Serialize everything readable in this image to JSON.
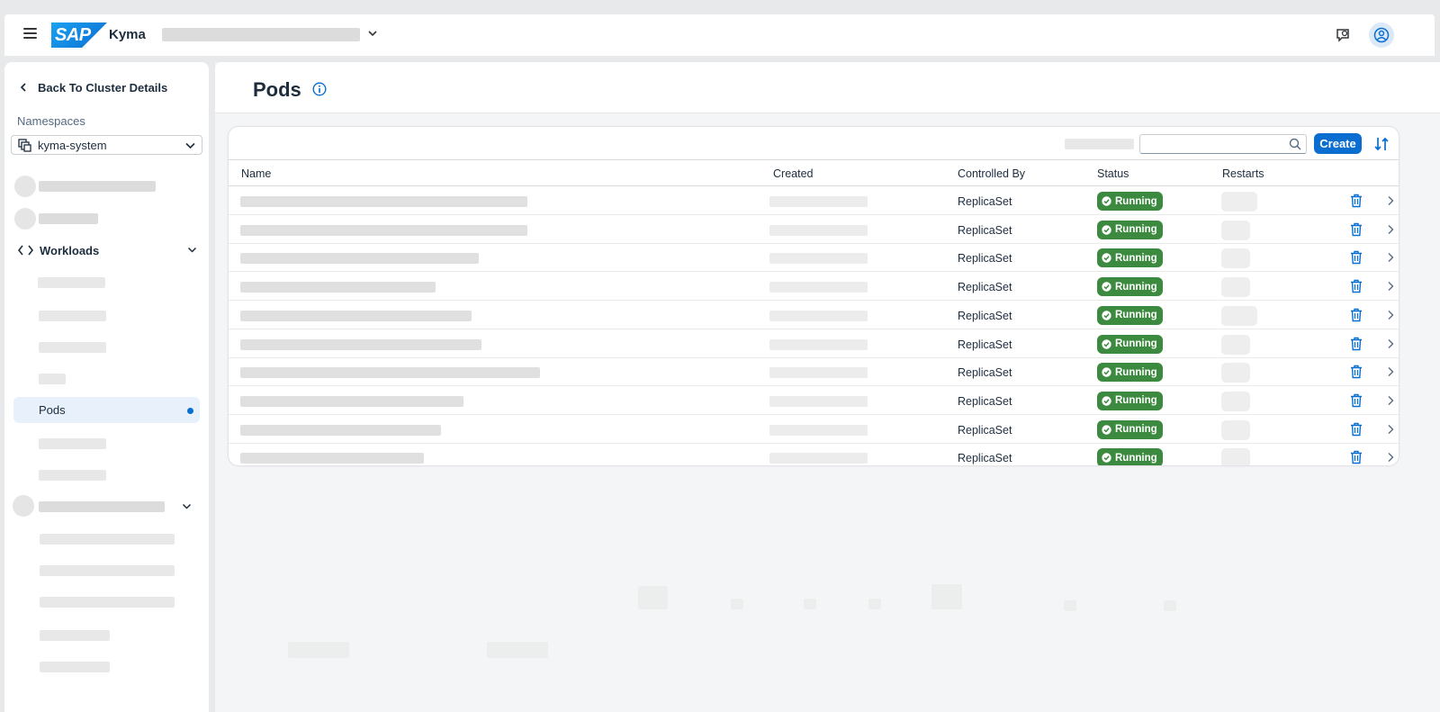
{
  "shell": {
    "product": "Kyma",
    "logo_text": "SAP"
  },
  "sidebar": {
    "back_label": "Back To Cluster Details",
    "namespaces_label": "Namespaces",
    "namespace_value": "kyma-system",
    "workloads_label": "Workloads",
    "active_item": "Pods"
  },
  "page": {
    "title": "Pods"
  },
  "toolbar": {
    "create_label": "Create",
    "search_value": ""
  },
  "table": {
    "headers": {
      "name": "Name",
      "created": "Created",
      "controlled_by": "Controlled By",
      "status": "Status",
      "restarts": "Restarts"
    },
    "rows": [
      {
        "controlled_by": "ReplicaSet",
        "status": "Running"
      },
      {
        "controlled_by": "ReplicaSet",
        "status": "Running"
      },
      {
        "controlled_by": "ReplicaSet",
        "status": "Running"
      },
      {
        "controlled_by": "ReplicaSet",
        "status": "Running"
      },
      {
        "controlled_by": "ReplicaSet",
        "status": "Running"
      },
      {
        "controlled_by": "ReplicaSet",
        "status": "Running"
      },
      {
        "controlled_by": "ReplicaSet",
        "status": "Running"
      },
      {
        "controlled_by": "ReplicaSet",
        "status": "Running"
      },
      {
        "controlled_by": "ReplicaSet",
        "status": "Running"
      },
      {
        "controlled_by": "ReplicaSet",
        "status": "Running"
      }
    ]
  },
  "colors": {
    "accent": "#0a6ed1",
    "success": "#3c8a3f",
    "active_nav": "#e8f1fb"
  },
  "icons": [
    "menu-icon",
    "feedback-icon",
    "user-icon",
    "chevron-left-icon",
    "namespace-icon",
    "chevron-down-icon",
    "code-icon",
    "info-icon",
    "search-icon",
    "sort-icon",
    "check-icon",
    "delete-icon",
    "chevron-right-icon"
  ]
}
